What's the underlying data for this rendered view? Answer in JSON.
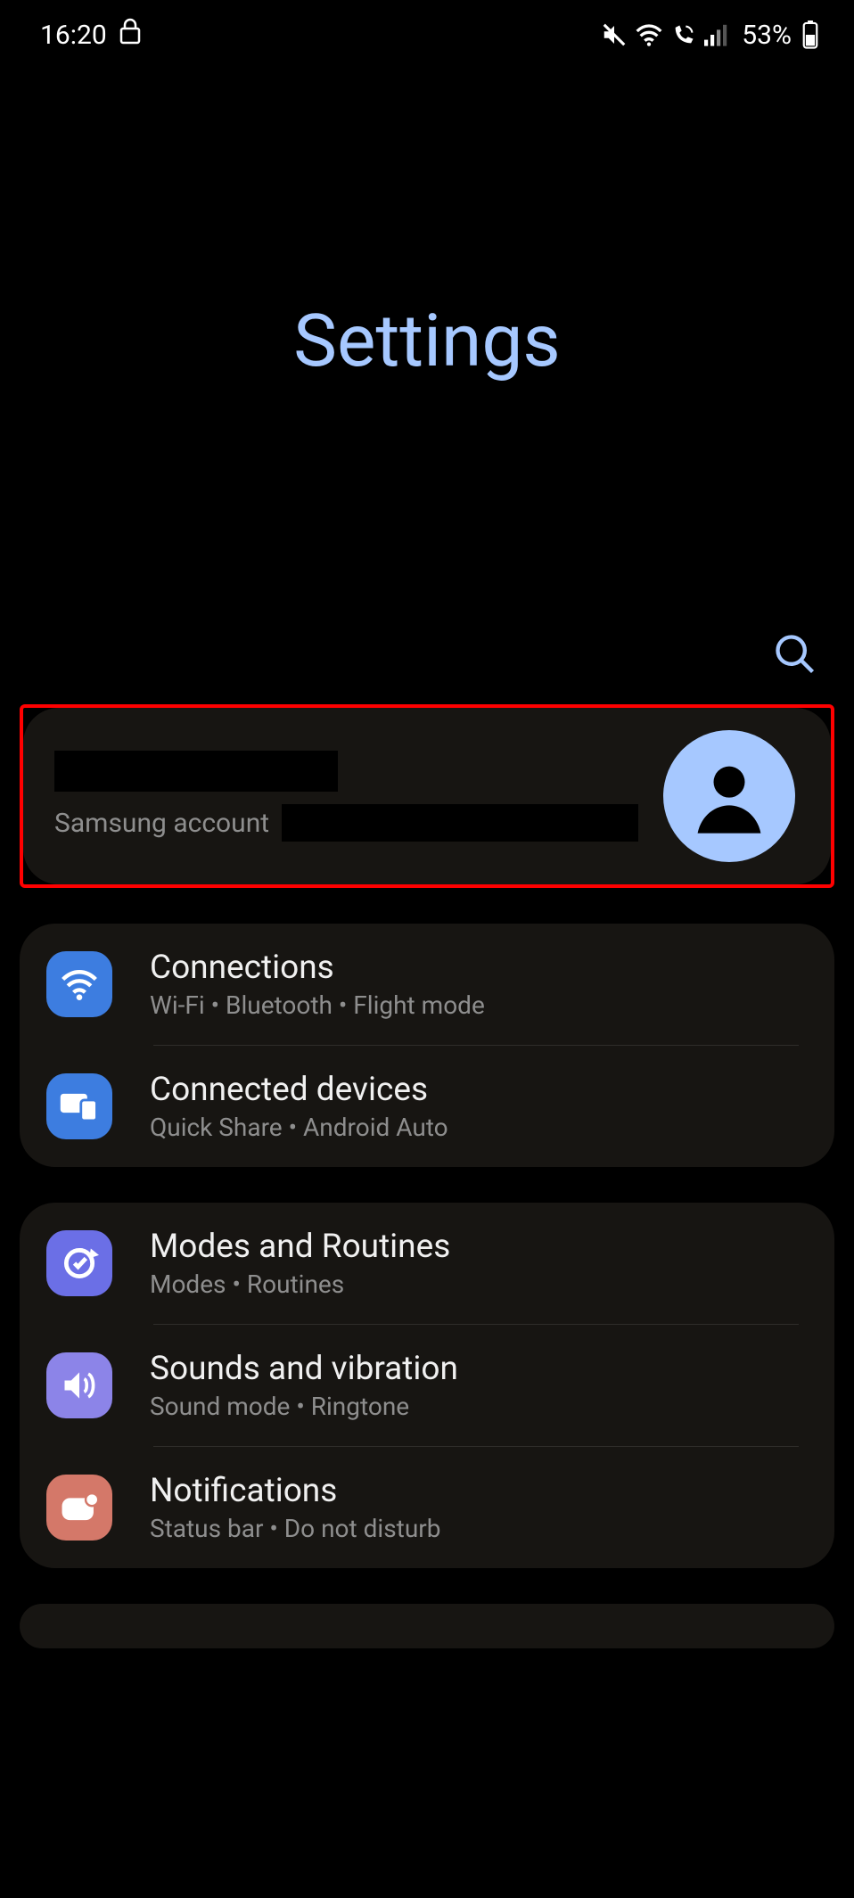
{
  "status": {
    "time": "16:20",
    "battery": "53%"
  },
  "title": "Settings",
  "account": {
    "label": "Samsung account"
  },
  "groups": [
    {
      "items": [
        {
          "title": "Connections",
          "sub": "Wi-Fi  •  Bluetooth  •  Flight mode"
        },
        {
          "title": "Connected devices",
          "sub": "Quick Share  •  Android Auto"
        }
      ]
    },
    {
      "items": [
        {
          "title": "Modes and Routines",
          "sub": "Modes  •  Routines"
        },
        {
          "title": "Sounds and vibration",
          "sub": "Sound mode  •  Ringtone"
        },
        {
          "title": "Notifications",
          "sub": "Status bar  •  Do not disturb"
        }
      ]
    }
  ]
}
